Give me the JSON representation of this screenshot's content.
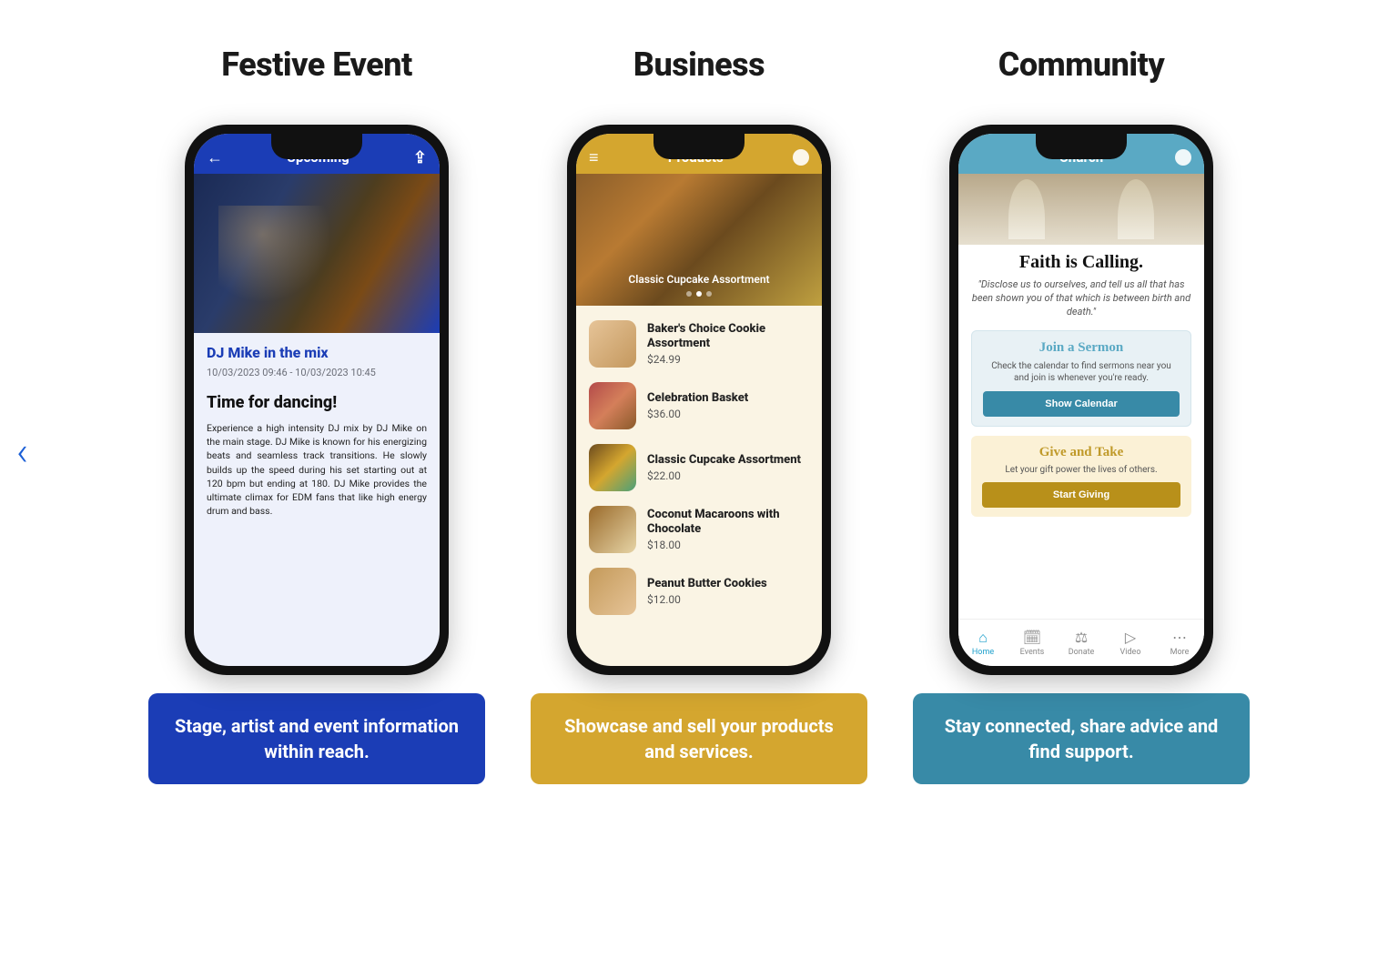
{
  "colors": {
    "blue": "#1b3db6",
    "gold": "#d4a62f",
    "teal": "#388aa7",
    "lightTeal": "#5aa9c4"
  },
  "columns": {
    "festive": {
      "heading": "Festive Event",
      "caption": "Stage, artist and event information within reach.",
      "appbar": {
        "title": "Upcoming",
        "back": "←",
        "share": "⇪"
      },
      "card": {
        "title": "DJ Mike in the mix",
        "date": "10/03/2023 09:46 - 10/03/2023 10:45",
        "subtitle": "Time for dancing!",
        "body": "Experience a high intensity DJ mix by DJ Mike on the main stage. DJ Mike is known for his energizing beats and seamless track transitions. He slowly builds up the speed during his set starting out at 120 bpm but ending at 180. DJ Mike provides the ultimate climax for EDM fans that like high energy drum and bass."
      }
    },
    "business": {
      "heading": "Business",
      "caption": "Showcase and sell your products and services.",
      "appbar": {
        "title": "Products",
        "menu": "≡",
        "profile": "●"
      },
      "hero": {
        "label": "Classic Cupcake Assortment"
      },
      "items": [
        {
          "name": "Baker's Choice Cookie Assortment",
          "price": "$24.99"
        },
        {
          "name": "Celebration Basket",
          "price": "$36.00"
        },
        {
          "name": "Classic Cupcake Assortment",
          "price": "$22.00"
        },
        {
          "name": "Coconut Macaroons with Chocolate",
          "price": "$18.00"
        },
        {
          "name": "Peanut Butter Cookies",
          "price": "$12.00"
        }
      ]
    },
    "community": {
      "heading": "Community",
      "caption": "Stay connected, share advice and find support.",
      "appbar": {
        "title": "Church",
        "profile": "●"
      },
      "hero": {
        "title": "Faith is Calling.",
        "quote": "\"Disclose us to ourselves, and tell us all that has been shown you of that which is between birth and death.\""
      },
      "sermon": {
        "title": "Join a Sermon",
        "body": "Check the calendar to find sermons near you and join is whenever you're ready.",
        "button": "Show Calendar"
      },
      "give": {
        "title": "Give and Take",
        "body": "Let your gift power the lives of others.",
        "button": "Start Giving"
      },
      "tabs": {
        "home": "Home",
        "events": "Events",
        "donate": "Donate",
        "video": "Video",
        "more": "More"
      }
    }
  },
  "arrows": {
    "left": "‹",
    "right": "›"
  }
}
